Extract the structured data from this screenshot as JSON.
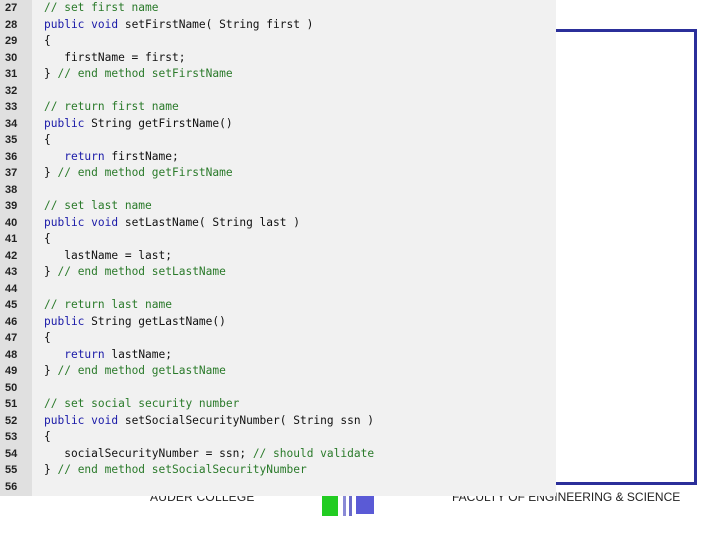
{
  "footer": {
    "left_text": "AUDER COLLEGE",
    "right_text": "FACULTY OF ENGINEERING & SCIENCE"
  },
  "colors": {
    "frame": "#2b2f9a",
    "keyword": "#1a1aa8",
    "comment": "#2a7a2a",
    "code_bg": "#f1f1f1",
    "gutter_bg": "#e0e0e0"
  },
  "code": {
    "lines": [
      {
        "n": "27",
        "tokens": [
          {
            "t": "// set first name",
            "c": "comment"
          }
        ]
      },
      {
        "n": "28",
        "tokens": [
          {
            "t": "public void ",
            "c": "kw"
          },
          {
            "t": "setFirstName( String first )",
            "c": "plain"
          }
        ]
      },
      {
        "n": "29",
        "tokens": [
          {
            "t": "{",
            "c": "plain"
          }
        ]
      },
      {
        "n": "30",
        "tokens": [
          {
            "t": "   firstName = first;",
            "c": "plain"
          }
        ]
      },
      {
        "n": "31",
        "tokens": [
          {
            "t": "} ",
            "c": "plain"
          },
          {
            "t": "// end method setFirstName",
            "c": "comment"
          }
        ]
      },
      {
        "n": "32",
        "tokens": []
      },
      {
        "n": "33",
        "tokens": [
          {
            "t": "// return first name",
            "c": "comment"
          }
        ]
      },
      {
        "n": "34",
        "tokens": [
          {
            "t": "public ",
            "c": "kw"
          },
          {
            "t": "String getFirstName()",
            "c": "plain"
          }
        ]
      },
      {
        "n": "35",
        "tokens": [
          {
            "t": "{",
            "c": "plain"
          }
        ]
      },
      {
        "n": "36",
        "tokens": [
          {
            "t": "   ",
            "c": "plain"
          },
          {
            "t": "return ",
            "c": "kw"
          },
          {
            "t": "firstName;",
            "c": "plain"
          }
        ]
      },
      {
        "n": "37",
        "tokens": [
          {
            "t": "} ",
            "c": "plain"
          },
          {
            "t": "// end method getFirstName",
            "c": "comment"
          }
        ]
      },
      {
        "n": "38",
        "tokens": []
      },
      {
        "n": "39",
        "tokens": [
          {
            "t": "// set last name",
            "c": "comment"
          }
        ]
      },
      {
        "n": "40",
        "tokens": [
          {
            "t": "public void ",
            "c": "kw"
          },
          {
            "t": "setLastName( String last )",
            "c": "plain"
          }
        ]
      },
      {
        "n": "41",
        "tokens": [
          {
            "t": "{",
            "c": "plain"
          }
        ]
      },
      {
        "n": "42",
        "tokens": [
          {
            "t": "   lastName = last;",
            "c": "plain"
          }
        ]
      },
      {
        "n": "43",
        "tokens": [
          {
            "t": "} ",
            "c": "plain"
          },
          {
            "t": "// end method setLastName",
            "c": "comment"
          }
        ]
      },
      {
        "n": "44",
        "tokens": []
      },
      {
        "n": "45",
        "tokens": [
          {
            "t": "// return last name",
            "c": "comment"
          }
        ]
      },
      {
        "n": "46",
        "tokens": [
          {
            "t": "public ",
            "c": "kw"
          },
          {
            "t": "String getLastName()",
            "c": "plain"
          }
        ]
      },
      {
        "n": "47",
        "tokens": [
          {
            "t": "{",
            "c": "plain"
          }
        ]
      },
      {
        "n": "48",
        "tokens": [
          {
            "t": "   ",
            "c": "plain"
          },
          {
            "t": "return ",
            "c": "kw"
          },
          {
            "t": "lastName;",
            "c": "plain"
          }
        ]
      },
      {
        "n": "49",
        "tokens": [
          {
            "t": "} ",
            "c": "plain"
          },
          {
            "t": "// end method getLastName",
            "c": "comment"
          }
        ]
      },
      {
        "n": "50",
        "tokens": []
      },
      {
        "n": "51",
        "tokens": [
          {
            "t": "// set social security number",
            "c": "comment"
          }
        ]
      },
      {
        "n": "52",
        "tokens": [
          {
            "t": "public void ",
            "c": "kw"
          },
          {
            "t": "setSocialSecurityNumber( String ssn )",
            "c": "plain"
          }
        ]
      },
      {
        "n": "53",
        "tokens": [
          {
            "t": "{",
            "c": "plain"
          }
        ]
      },
      {
        "n": "54",
        "tokens": [
          {
            "t": "   socialSecurityNumber = ssn; ",
            "c": "plain"
          },
          {
            "t": "// should validate",
            "c": "comment"
          }
        ]
      },
      {
        "n": "55",
        "tokens": [
          {
            "t": "} ",
            "c": "plain"
          },
          {
            "t": "// end method setSocialSecurityNumber",
            "c": "comment"
          }
        ]
      },
      {
        "n": "56",
        "tokens": []
      }
    ]
  }
}
